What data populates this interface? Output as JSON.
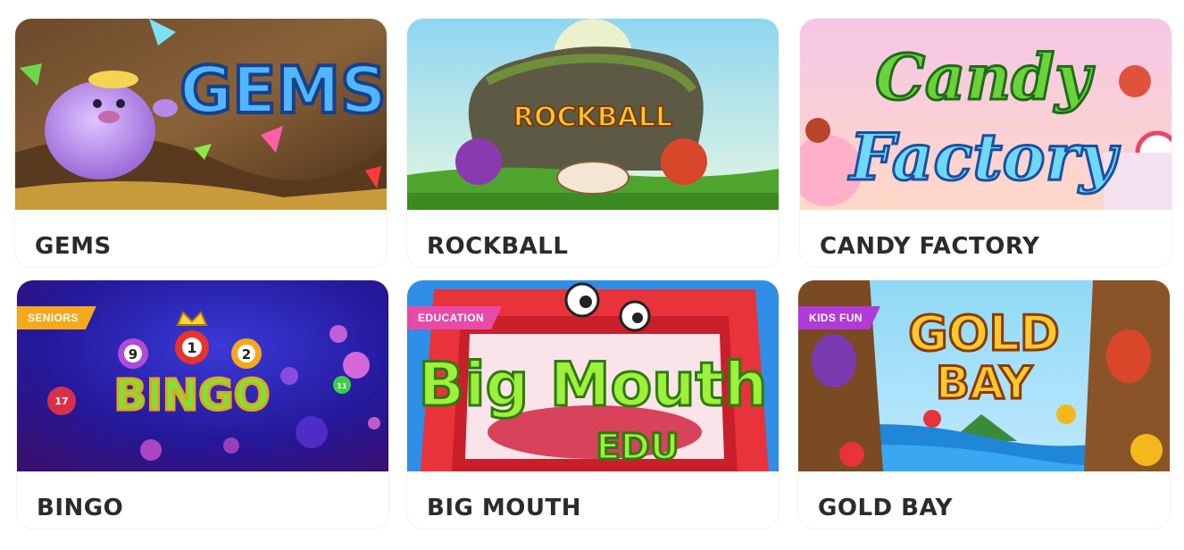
{
  "games": [
    {
      "title": "GEMS",
      "logo": "GEMS",
      "tag": ""
    },
    {
      "title": "ROCKBALL",
      "logo": "ROCKBALL",
      "tag": ""
    },
    {
      "title": "CANDY FACTORY",
      "logo_line1": "Candy",
      "logo_line2": "Factory",
      "tag": ""
    },
    {
      "title": "BINGO",
      "logo": "BINGO",
      "balls": [
        "9",
        "1",
        "2"
      ],
      "deco_balls": [
        "17",
        "11"
      ],
      "tag": "SENIORS",
      "tag_color": "#f5a81c"
    },
    {
      "title": "BIG MOUTH",
      "logo_line1": "Big Mouth",
      "logo_line2": "EDU",
      "tag": "EDUCATION",
      "tag_color": "#e84aa8"
    },
    {
      "title": "GOLD BAY",
      "logo_line1": "GOLD",
      "logo_line2": "BAY",
      "tag": "KIDS FUN",
      "tag_color": "#b13ad8"
    }
  ]
}
